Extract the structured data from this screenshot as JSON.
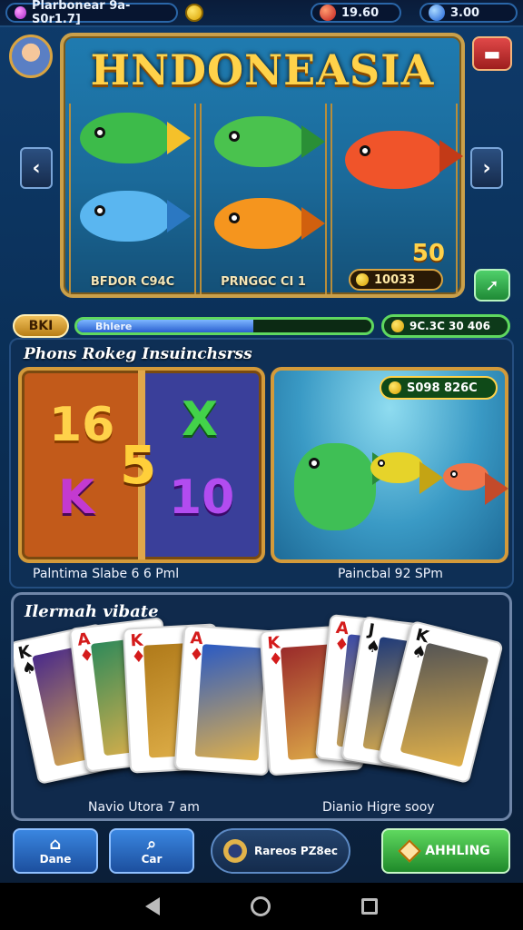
{
  "topbar": {
    "player_label": "Plarbonear 9a-S0r1.7]",
    "red_balance": "19.60",
    "blue_balance": "3.00"
  },
  "slot": {
    "title": "HNDONEASIA",
    "reel_captions": [
      "BFDOR C94C",
      "PRNGGC CI 1",
      ""
    ],
    "win_badge": "50",
    "win_value": "10033"
  },
  "progress": {
    "bet_tag": "BKI",
    "bar_label": "Bhlere",
    "bar_fraction": 0.6,
    "jackpot": "9C.3C 30 406"
  },
  "section2": {
    "title": "Phons Rokeg Insuinchsrss",
    "symbols": [
      "16",
      "5",
      "X",
      "K",
      "10"
    ],
    "multiplier": "S098 826C",
    "left_caption": "Palntima Slabe 6 6 Pml",
    "right_caption": "Paincbal 92 SPm"
  },
  "section3": {
    "title": "Ilermah vibate",
    "cards": [
      {
        "rank": "K",
        "suit": "♠",
        "color": "#111",
        "art": "#4a2a8a"
      },
      {
        "rank": "A",
        "suit": "♦",
        "color": "#d41b1b",
        "art": "#2f8a5a"
      },
      {
        "rank": "K",
        "suit": "♦",
        "color": "#d41b1b",
        "art": "#b07a1a"
      },
      {
        "rank": "A",
        "suit": "♦",
        "color": "#d41b1b",
        "art": "#2a5ac4"
      },
      {
        "rank": "K",
        "suit": "♦",
        "color": "#d41b1b",
        "art": "#9a2a2a"
      },
      {
        "rank": "A",
        "suit": "♦",
        "color": "#d41b1b",
        "art": "#3a4aa8"
      },
      {
        "rank": "J",
        "suit": "♠",
        "color": "#111",
        "art": "#1e3a7a"
      },
      {
        "rank": "K",
        "suit": "♠",
        "color": "#111",
        "art": "#555"
      }
    ],
    "left_caption": "Navio Utora 7 am",
    "right_caption": "Dianio Higre sooy"
  },
  "buttons": {
    "b1": "Dane",
    "b2": "Car",
    "b3": "Rareos PZ8ec",
    "b4": "AHHLING"
  },
  "colors": {
    "gold": "#d9a441",
    "green": "#5fd85f",
    "panel": "#0e2f55"
  }
}
